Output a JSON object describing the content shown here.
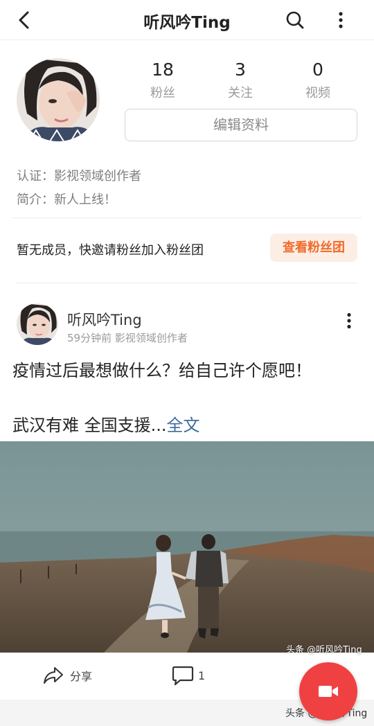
{
  "header": {
    "title": "听风吟Ting",
    "back_icon": "chevron-left-icon",
    "search_icon": "search-icon",
    "more_icon": "more-vertical-icon"
  },
  "profile": {
    "stats": [
      {
        "value": "18",
        "label": "粉丝"
      },
      {
        "value": "3",
        "label": "关注"
      },
      {
        "value": "0",
        "label": "视频"
      }
    ],
    "edit_label": "编辑资料",
    "verification": "认证：影视领域创作者",
    "bio": "简介：新人上线！"
  },
  "fan_group": {
    "text": "暂无成员，快邀请粉丝加入粉丝团",
    "button_label": "查看粉丝团",
    "accent_color": "#f06a2a"
  },
  "post": {
    "author": "听风吟Ting",
    "meta": "59分钟前 影视领域创作者",
    "line1": "疫情过后最想做什么？给自己许个愿吧！",
    "line2": "武汉有难  全国支援...",
    "full_text_link": "全文",
    "image_watermark": "头条 @听风吟Ting",
    "actions": {
      "share_label": "分享",
      "comment_count": "1"
    }
  },
  "footer": {
    "watermark": "头条 @听风吟Ting"
  },
  "fab": {
    "icon": "video-camera-icon",
    "color": "#f04142"
  }
}
